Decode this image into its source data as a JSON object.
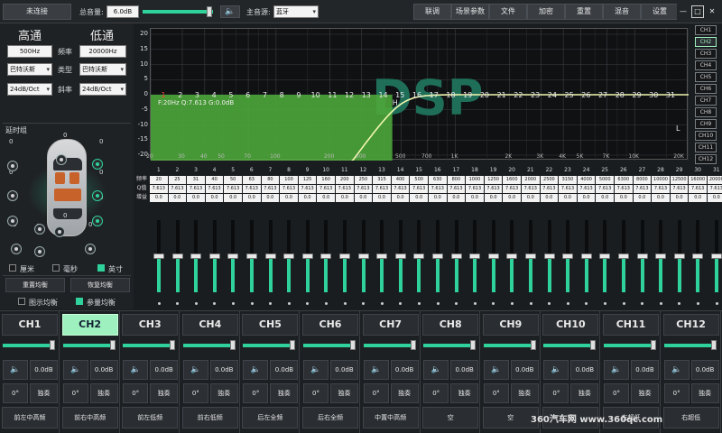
{
  "topbar": {
    "connect_label": "未连接",
    "master_volume_label": "总音量:",
    "master_volume_value": "6.0dB",
    "master_volume_level": 0.95,
    "main_source_label": "主音源:",
    "main_source_value": "蓝牙",
    "buttons": [
      "联调",
      "场景参数",
      "文件",
      "加密",
      "重置",
      "混音",
      "设置"
    ],
    "win_min": "—",
    "win_max": "□",
    "win_close": "✕"
  },
  "crossover": {
    "high_title": "高通",
    "low_title": "低通",
    "freq_label": "频率",
    "type_label": "类型",
    "slope_label": "斜率",
    "high_freq": "500Hz",
    "low_freq": "20000Hz",
    "high_type": "巴特沃斯",
    "low_type": "巴特沃斯",
    "high_slope": "24dB/Oct",
    "low_slope": "24dB/Oct"
  },
  "delay": {
    "title": "延时组",
    "units": [
      {
        "label": "厘米",
        "checked": false
      },
      {
        "label": "毫秒",
        "checked": false
      },
      {
        "label": "英寸",
        "checked": true
      }
    ],
    "speaker_values": [
      "0",
      "0",
      "0",
      "0",
      "0",
      "0",
      "0",
      "0",
      "0",
      "0",
      "0",
      "0"
    ]
  },
  "eq_controls": {
    "reset_eq": "重置均衡",
    "restore_eq": "恢复均衡",
    "graphic_eq": "图示均衡",
    "graphic_eq_checked": false,
    "param_eq": "参量均衡",
    "param_eq_checked": true
  },
  "graph": {
    "watermark": "DSP",
    "info": "F:20Hz Q:7.613 G:0.0dB",
    "marker_h": "H",
    "marker_l": "L",
    "y_ticks": [
      "20",
      "15",
      "10",
      "5",
      "0",
      "-5",
      "-10",
      "-15",
      "-20"
    ],
    "x_ticks": [
      "20",
      "30",
      "40",
      "50",
      "70",
      "100",
      "200",
      "300",
      "500",
      "700",
      "1K",
      "2K",
      "3K",
      "4K",
      "5K",
      "7K",
      "10K",
      "20K"
    ],
    "band_markers": [
      "1",
      "2",
      "3",
      "4",
      "5",
      "6",
      "7",
      "8",
      "9",
      "10",
      "11",
      "12",
      "13",
      "14",
      "15",
      "16",
      "17",
      "18",
      "19",
      "20",
      "21",
      "22",
      "23",
      "24",
      "25",
      "26",
      "27",
      "28",
      "29",
      "30",
      "31"
    ]
  },
  "channels_list": [
    "CH1",
    "CH2",
    "CH3",
    "CH4",
    "CH5",
    "CH6",
    "CH7",
    "CH8",
    "CH9",
    "CH10",
    "CH11",
    "CH12"
  ],
  "channels_list_active": 1,
  "eq_table": {
    "row_labels": [
      "频率",
      "Q值",
      "增益"
    ],
    "bands": [
      "1",
      "2",
      "3",
      "4",
      "5",
      "6",
      "7",
      "8",
      "9",
      "10",
      "11",
      "12",
      "13",
      "14",
      "15",
      "16",
      "17",
      "18",
      "19",
      "20",
      "21",
      "22",
      "23",
      "24",
      "25",
      "26",
      "27",
      "28",
      "29",
      "30",
      "31"
    ],
    "freqs": [
      "20",
      "25",
      "31",
      "40",
      "50",
      "63",
      "80",
      "100",
      "125",
      "160",
      "200",
      "250",
      "315",
      "400",
      "500",
      "630",
      "800",
      "1000",
      "1250",
      "1600",
      "2000",
      "2500",
      "3150",
      "4000",
      "5000",
      "6300",
      "8000",
      "10000",
      "12500",
      "16000",
      "20000"
    ],
    "q_value": "7.613",
    "gain_value": "0.0"
  },
  "eq_slider_level": 0.5,
  "channel_strips": [
    {
      "label": "CH1",
      "level": 0.95,
      "gain": "0.0dB",
      "phase": "0°",
      "solo": "独奏",
      "name": "前左中高频"
    },
    {
      "label": "CH2",
      "level": 0.95,
      "gain": "0.0dB",
      "phase": "0°",
      "solo": "独奏",
      "name": "前右中高频"
    },
    {
      "label": "CH3",
      "level": 0.95,
      "gain": "0.0dB",
      "phase": "0°",
      "solo": "独奏",
      "name": "前左低频"
    },
    {
      "label": "CH4",
      "level": 0.95,
      "gain": "0.0dB",
      "phase": "0°",
      "solo": "独奏",
      "name": "前右低频"
    },
    {
      "label": "CH5",
      "level": 0.95,
      "gain": "0.0dB",
      "phase": "0°",
      "solo": "独奏",
      "name": "后左全频"
    },
    {
      "label": "CH6",
      "level": 0.95,
      "gain": "0.0dB",
      "phase": "0°",
      "solo": "独奏",
      "name": "后右全频"
    },
    {
      "label": "CH7",
      "level": 0.95,
      "gain": "0.0dB",
      "phase": "0°",
      "solo": "独奏",
      "name": "中置中高频"
    },
    {
      "label": "CH8",
      "level": 0.95,
      "gain": "0.0dB",
      "phase": "0°",
      "solo": "独奏",
      "name": "空"
    },
    {
      "label": "CH9",
      "level": 0.95,
      "gain": "0.0dB",
      "phase": "0°",
      "solo": "独奏",
      "name": "空"
    },
    {
      "label": "CH10",
      "level": 0.95,
      "gain": "0.0dB",
      "phase": "0°",
      "solo": "独奏",
      "name": "空"
    },
    {
      "label": "CH11",
      "level": 0.95,
      "gain": "0.0dB",
      "phase": "0°",
      "solo": "独奏",
      "name": "左超低"
    },
    {
      "label": "CH12",
      "level": 0.95,
      "gain": "0.0dB",
      "phase": "0°",
      "solo": "独奏",
      "name": "右超低"
    }
  ],
  "active_channel": 1,
  "watermark_text": "360汽车网 www.360qc.com",
  "colors": {
    "accent": "#2fd29a",
    "active_channel": "#9ff0bf"
  },
  "icons": {
    "speaker": "speaker-icon",
    "close": "close-icon",
    "minimize": "minimize-icon",
    "maximize": "maximize-icon"
  }
}
